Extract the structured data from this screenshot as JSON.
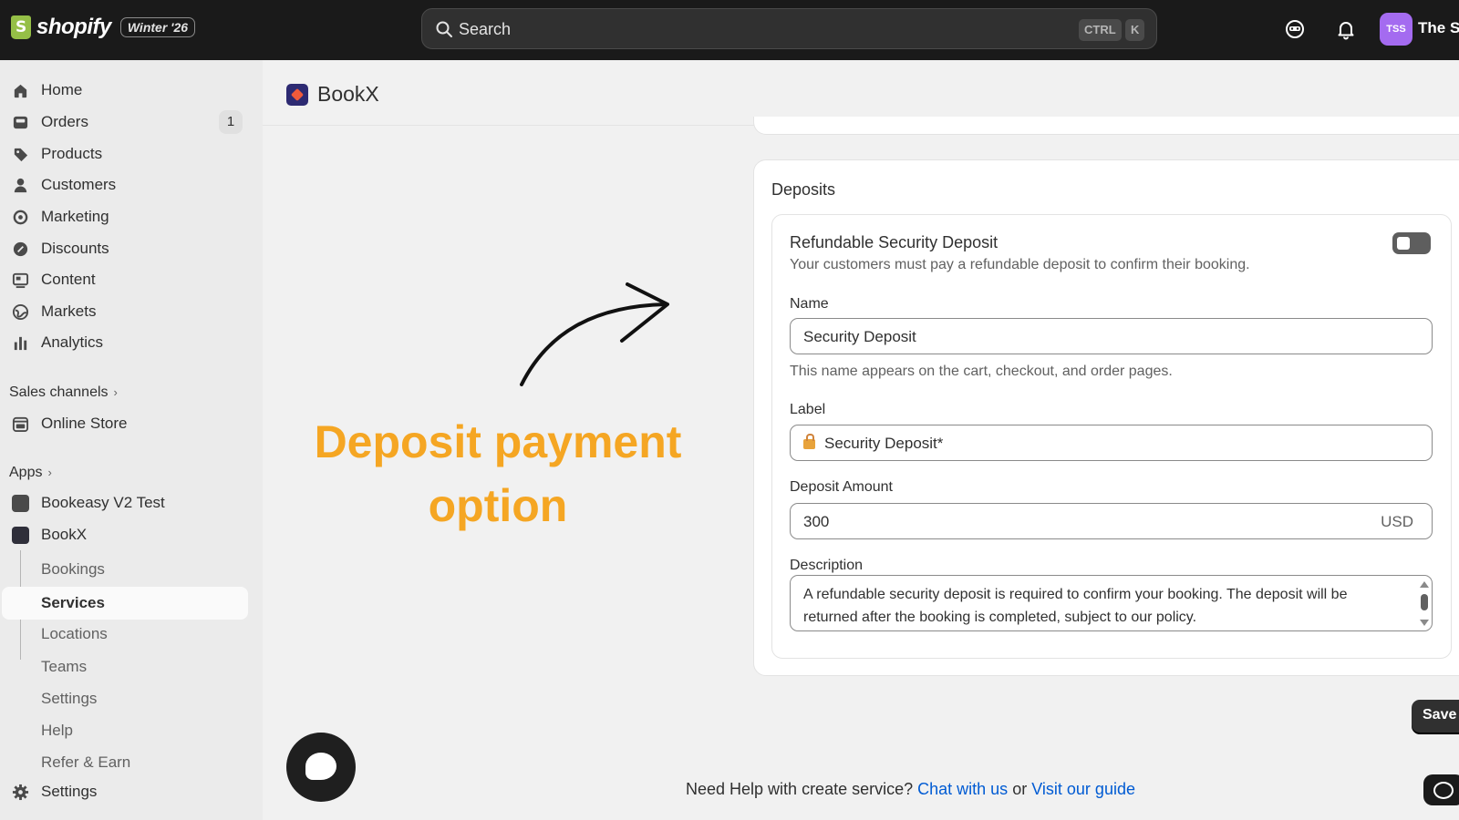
{
  "topbar": {
    "brand": "shopify",
    "edition": "Winter '26",
    "search_placeholder": "Search",
    "kbd_ctrl": "CTRL",
    "kbd_k": "K",
    "avatar_initials": "TSS",
    "store_name": "The St"
  },
  "sidebar": {
    "items": [
      {
        "label": "Home",
        "icon": "home-icon"
      },
      {
        "label": "Orders",
        "icon": "orders-icon",
        "badge": "1"
      },
      {
        "label": "Products",
        "icon": "tag-icon"
      },
      {
        "label": "Customers",
        "icon": "person-icon"
      },
      {
        "label": "Marketing",
        "icon": "target-icon"
      },
      {
        "label": "Discounts",
        "icon": "discount-icon"
      },
      {
        "label": "Content",
        "icon": "content-icon"
      },
      {
        "label": "Markets",
        "icon": "globe-icon"
      },
      {
        "label": "Analytics",
        "icon": "bar-chart-icon"
      }
    ],
    "sales_channels": "Sales channels",
    "online_store": "Online Store",
    "apps": "Apps",
    "app_bookeasy": "Bookeasy V2 Test",
    "app_bookx": "BookX",
    "sub_items": [
      "Bookings",
      "Services",
      "Locations",
      "Teams",
      "Settings",
      "Help",
      "Refer & Earn"
    ],
    "settings": "Settings"
  },
  "app": {
    "title": "BookX"
  },
  "deposits": {
    "card_title": "Deposits",
    "section_title": "Refundable Security Deposit",
    "section_desc": "Your customers must pay a refundable deposit to confirm their booking.",
    "toggle_on": false,
    "name_label": "Name",
    "name_value": "Security Deposit",
    "name_help": "This name appears on the cart, checkout, and order pages.",
    "label_label": "Label",
    "label_value": "Security Deposit*",
    "amount_label": "Deposit Amount",
    "amount_value": "300",
    "amount_currency": "USD",
    "description_label": "Description",
    "description_value": "A refundable security deposit is required to confirm your booking. The deposit will be returned after the booking is completed, subject to our policy."
  },
  "annotation": {
    "line1": "Deposit payment",
    "line2": "option"
  },
  "footer": {
    "save": "Save",
    "help_prefix": "Need Help with create service?",
    "chat_link": "Chat with us",
    "or": "or",
    "guide_link": "Visit our guide"
  }
}
